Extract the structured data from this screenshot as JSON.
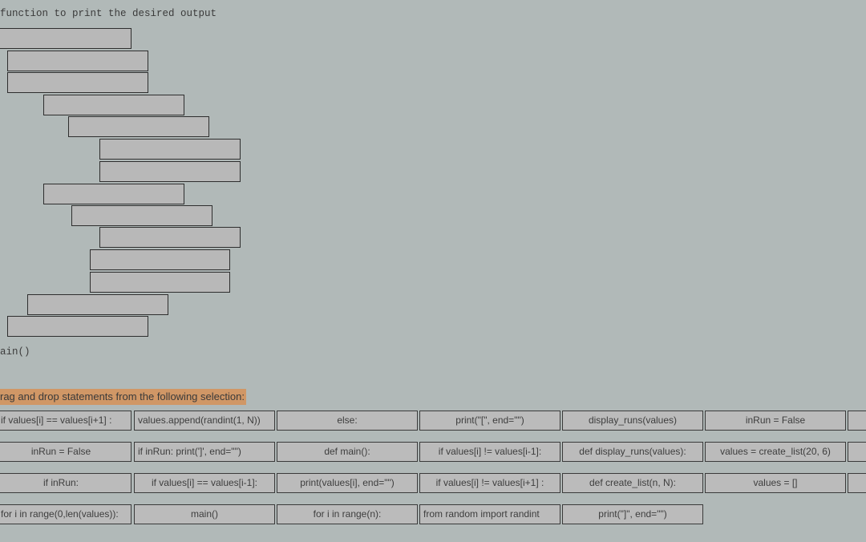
{
  "code": {
    "header_line": "function to print the desired output",
    "footer_line": "ain()"
  },
  "instructions": "rag and drop statements from the following selection:",
  "chips": [
    [
      "if values[i] == values[i+1] :",
      "values.append(randint(1, N))",
      "else:",
      "print(\"[\", end=\"\")",
      "display_runs(values)",
      "inRun = False"
    ],
    [
      "inRun = False",
      "if inRun: print(']', end=\"\")",
      "def main():",
      "if values[i] != values[i-1]:",
      "def display_runs(values):",
      "values = create_list(20, 6)"
    ],
    [
      "if inRun:",
      "if values[i] == values[i-1]:",
      "print(values[i], end=\"\")",
      "if values[i] != values[i+1] :",
      "def create_list(n, N):",
      "values = []"
    ],
    [
      "for i in range(0,len(values)):",
      "main()",
      "for i in range(n):",
      "from random import randint",
      "print(\"]\", end=\"\")"
    ]
  ]
}
